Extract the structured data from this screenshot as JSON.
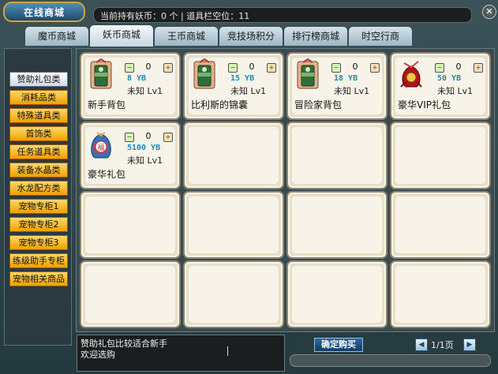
{
  "title": "在线商城",
  "status": "当前持有妖币：0 个 | 道具栏空位：11",
  "close_symbol": "✕",
  "tabs": [
    "魔币商城",
    "妖币商城",
    "王币商城",
    "竞技场积分",
    "排行榜商城",
    "时空行商"
  ],
  "active_tab": 1,
  "sidebar": [
    "赞助礼包类",
    "消耗品类",
    "特殊道具类",
    "首饰类",
    "任务道具类",
    "装备水晶类",
    "水龙配方类",
    "宠物专柜1",
    "宠物专柜2",
    "宠物专柜3",
    "练级助手专柜",
    "宠物相关商品"
  ],
  "active_sidebar": 0,
  "items": [
    {
      "name": "新手背包",
      "price": "8 YB",
      "qty": "0",
      "meta": "未知 Lv1",
      "icon": "green-bag-icon"
    },
    {
      "name": "比利斯的锦囊",
      "price": "15 YB",
      "qty": "0",
      "meta": "未知 Lv1",
      "icon": "green-bag-icon"
    },
    {
      "name": "冒险家背包",
      "price": "18 YB",
      "qty": "0",
      "meta": "未知 Lv1",
      "icon": "green-bag-icon"
    },
    {
      "name": "豪华VIP礼包",
      "price": "50 YB",
      "qty": "0",
      "meta": "未知 Lv1",
      "icon": "red-pouch-icon"
    },
    {
      "name": "豪华礼包",
      "price": "5100 YB",
      "qty": "0",
      "meta": "未知 Lv1",
      "icon": "fortune-bag-icon"
    }
  ],
  "mini_minus": "−",
  "mini_plus": "+",
  "description_lines": [
    "赞助礼包比较适合新手",
    "欢迎选购"
  ],
  "buy_button": "确定购买",
  "page_info": "1/1页",
  "prev_symbol": "◀",
  "next_symbol": "▶",
  "colors": {
    "price": "#1b8bb7",
    "sidebar_item": "#f2a000",
    "tab_active": "#f2f8fb"
  }
}
